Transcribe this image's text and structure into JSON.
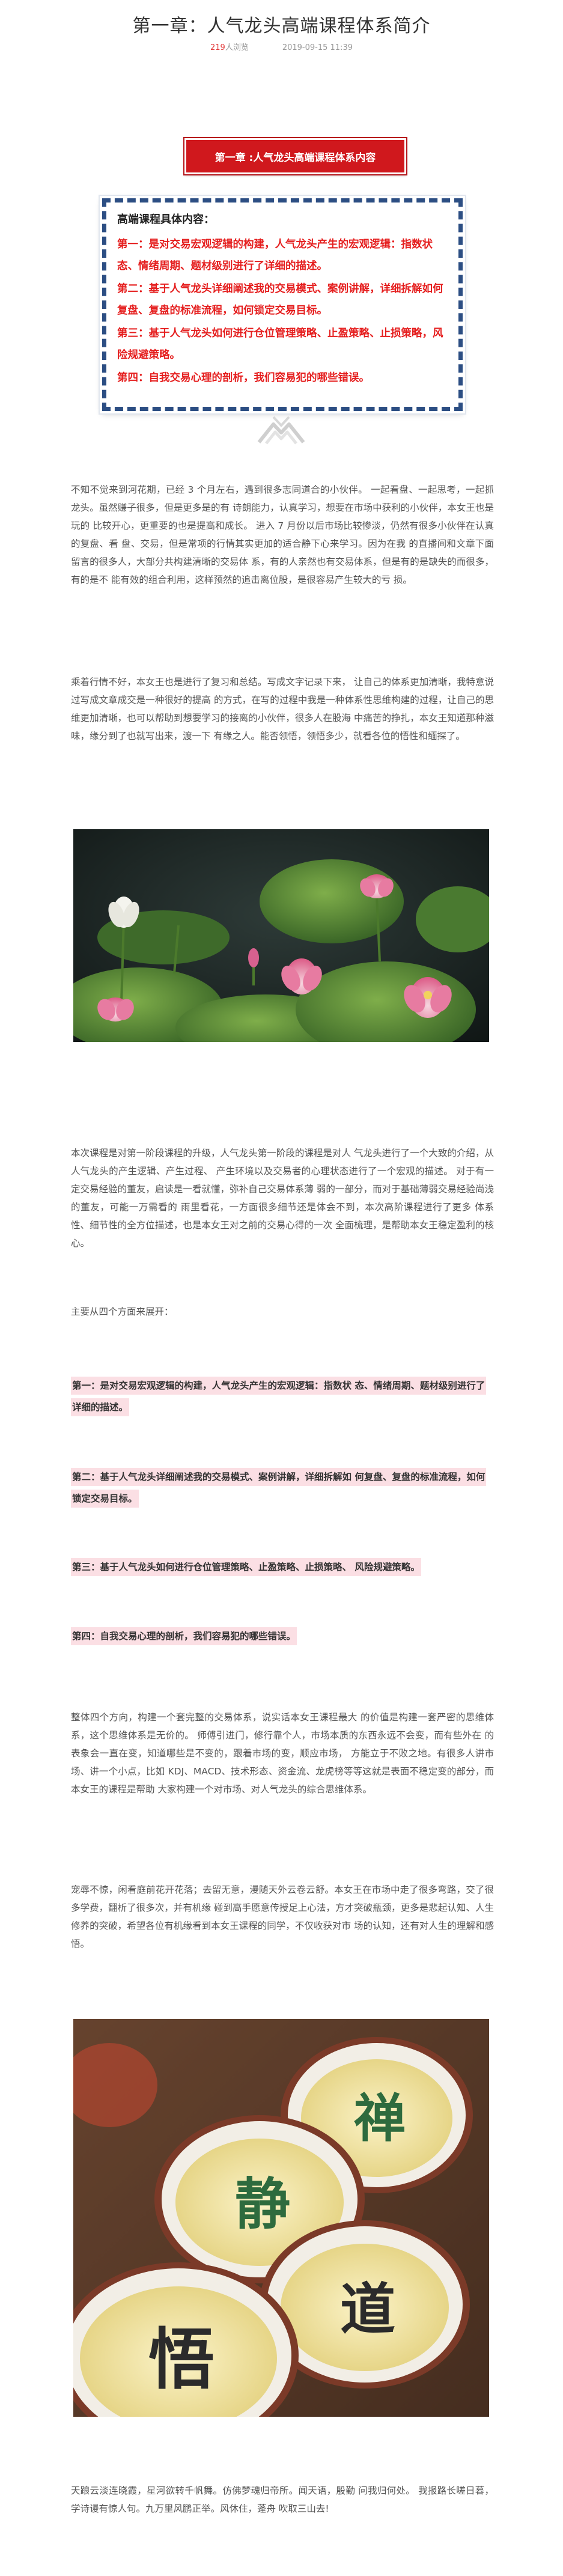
{
  "article": {
    "title": "第一章：人气龙头高端课程体系简介",
    "views_count": "219",
    "views_suffix": "人浏览",
    "date": "2019-09-15 11:39"
  },
  "chapter_box": {
    "label": "第一章 :人气龙头高端课程体系内容"
  },
  "syllabus": {
    "heading": "高端课程具体内容：",
    "items": [
      "第一：是对交易宏观逻辑的构建，人气龙头产生的宏观逻辑：指数状态、情绪周期、题材级别进行了详细的描述。",
      "第二：基于人气龙头详细阐述我的交易模式、案例讲解，详细拆解如何复盘、复盘的标准流程，如何锁定交易目标。",
      "第三：基于人气龙头如何进行仓位管理策略、止盈策略、止损策略，风险规避策略。",
      "第四：自我交易心理的剖析，我们容易犯的哪些错误。"
    ]
  },
  "icons": {
    "ribbon": "ribbon-flourish-icon"
  },
  "paragraphs": {
    "p1": "不知不觉来到河花期，已经 3 个月左右，遇到很多志同道合的小伙伴。 一起看盘、一起思考，一起抓龙头。虽然赚子很多，但是更多是的有 诗朗能力，认真学习，想要在市场中获利的小伙伴，本女王也是玩的 比较开心，更重要的也是提高和成长。 进入 7 月份以后市场比较惨淡，仍然有很多小伙伴在认真的复盘、看 盘、交易，但是常项的行情其实更加的适合静下心来学习。因为在我 的直播间和文章下面留言的很多人，大部分共构建清晰的交易体 系，有的人亲然也有交易体系，但是有的是缺失的而很多，有的是不 能有效的组合利用，这样预然的追击离位股，是很容易产生较大的亏 损。",
    "p2": "乘着行情不好，本女王也是进行了复习和总结。写成文字记录下来， 让自己的体系更加清晰，我特意说过写成文章成交是一种很好的提高 的方式，在写的过程中我是一种体系性思维构建的过程，让自己的思 维更加清晰，也可以帮助到想要学习的接离的小伙伴，很多人在股海 中痛苦的挣扎，本女王知道那种滋味，缘分到了也就写出来，渡一下 有缘之人。能否领悟，领悟多少，就看各位的悟性和缅探了。",
    "p3": "本次课程是对第一阶段课程的升级，人气龙头第一阶段的课程是对人 气龙头进行了一个大致的介绍，从人气龙头的产生逻辑、产生过程、 产生环境以及交易者的心理状态进行了一个宏观的描述。 对于有一定交易经验的董友，启读是一看就懂，弥补自己交易体系薄 弱的一部分，而对于基础薄弱交易经验尚浅的董友，可能一万需看的 雨里看花，一方面很多细节还是体会不到，本次高阶课程进行了更多 体系性、细节性的全方位描述，也是本女王对之前的交易心得的一次 全面梳理，是帮助本女王稳定盈利的核心。",
    "p4": "主要从四个方面来展开：",
    "p5": "整体四个方向，构建一个套完整的交易体系，说实话本女王课程最大 的价值是构建一套严密的思维体系，这个思维体系是无价的。 师傅引进门，修行靠个人，市场本质的东西永远不会变，而有些外在 的表象会一直在变，知道哪些是不变的，跟着市场的变，顺应市场， 方能立于不败之地。有很多人讲市场、讲一个小点，比如 KDJ、MACD、技术形态、资金流、龙虎榜等等这就是表面不稳定变的部分，而本女王的课程是帮助 大家构建一个对市场、对人气龙头的综合思维体系。",
    "p6": "宠辱不惊，闲看庭前花开花落；去留无意，漫随天外云卷云舒。本女王在市场中走了很多弯路，交了很多学费，翻析了很多次，并有机缘 碰到高手愿意传授足上心法，方才突破瓶颈，更多是悲起认知、人生 修养的突破，希望各位有机缘看到本女王课程的同学，不仅收获对市 场的认知，还有对人生的理解和感悟。",
    "p7": "天踉云淡连晓霞，星河欲转千帆舞。仿佛梦魂归帝所。闻天语，殷勤 问我归何处。 我报路长嗟日暮，学诗谩有惊人句。九万里风鹏正举。风休住，蓬舟 吹取三山去!"
  },
  "highlights": [
    "第一：是对交易宏观逻辑的构建，人气龙头产生的宏观逻辑：指数状 态、情绪周期、题材级别进行了详细的描述。",
    "第二：基于人气龙头详细阐述我的交易模式、案例讲解，详细拆解如 何复盘、复盘的标准流程，如何锁定交易目标。",
    "第三：基于人气龙头如何进行仓位管理策略、止盈策略、止损策略、 风险规避策略。",
    "第四：自我交易心理的剖析，我们容易犯的哪些错误。"
  ],
  "images": {
    "lotus": "lotus-pond-photo",
    "tea": "tea-cups-calligraphy-photo",
    "tea_cups": [
      {
        "char": "禅"
      },
      {
        "char": "静"
      },
      {
        "char": "道"
      },
      {
        "char": "悟"
      }
    ]
  }
}
